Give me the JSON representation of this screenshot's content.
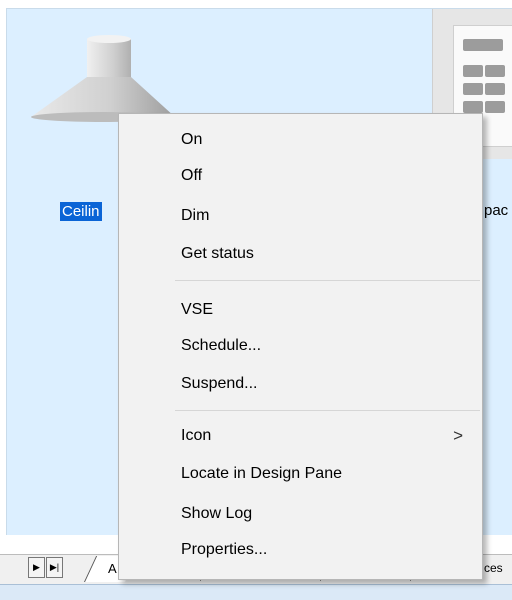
{
  "devices": {
    "selected_label": "Ceilin",
    "partial_label": "pac"
  },
  "tabs": {
    "first_tab": "A",
    "last_tab": "ces"
  },
  "context_menu": {
    "group1": [
      "On",
      "Off",
      "Dim",
      "Get status"
    ],
    "group2": [
      "VSE",
      "Schedule...",
      "Suspend..."
    ],
    "group3": [
      {
        "label": "Icon",
        "submenu_arrow": ">"
      },
      {
        "label": "Locate in Design Pane"
      },
      {
        "label": "Show Log"
      },
      {
        "label": "Properties..."
      }
    ]
  },
  "colors": {
    "pane_background": "#dcefff",
    "selection": "#0a64d6",
    "menu_background": "#f2f2f2"
  }
}
